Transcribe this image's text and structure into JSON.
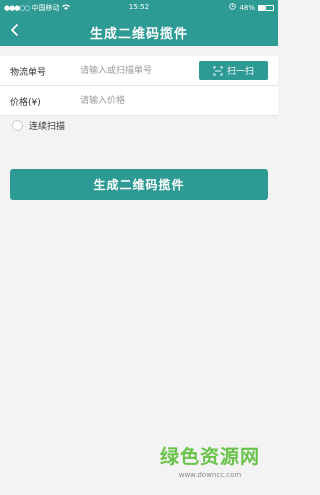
{
  "status_bar": {
    "carrier": "中国移动",
    "time": "15:52",
    "battery_percent_label": "48%",
    "battery_level": 0.48
  },
  "header": {
    "title": "生成二维码揽件",
    "back_icon": "chevron-left-icon"
  },
  "form": {
    "tracking": {
      "label": "物流单号",
      "placeholder": "请输入或扫描单号",
      "value": ""
    },
    "price": {
      "label": "价格(¥)",
      "placeholder": "请输入价格",
      "value": ""
    },
    "scan_button": {
      "label": "扫一扫",
      "icon": "scan-icon"
    }
  },
  "continuous_scan": {
    "label": "连续扫描",
    "checked": false
  },
  "submit_button": {
    "label": "生成二维码揽件"
  },
  "watermark": {
    "logo_text": "绿色资源网",
    "url": "www.downcc.com"
  },
  "colors": {
    "accent": "#2e9a94",
    "watermark_green": "#69c24a"
  }
}
